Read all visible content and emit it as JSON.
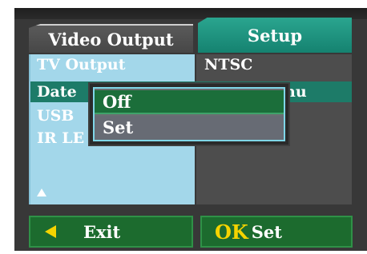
{
  "tabs": {
    "video_output": "Video Output",
    "setup": "Setup"
  },
  "menu": {
    "items": [
      {
        "label": "TV Output"
      },
      {
        "label": "Date"
      },
      {
        "label": "USB"
      },
      {
        "label": "IR LE"
      }
    ],
    "values": [
      {
        "label": "NTSC"
      },
      {
        "label": "nu"
      }
    ]
  },
  "popup": {
    "options": [
      {
        "label": "Off"
      },
      {
        "label": "Set"
      }
    ],
    "selected": "Off"
  },
  "footer": {
    "exit_label": "Exit",
    "ok_key": "OK",
    "ok_label": "Set"
  },
  "colors": {
    "accent_teal": "#158270",
    "selection_green": "#1b6e3a",
    "list_blue": "#a3d7ea",
    "key_yellow": "#f5d400"
  },
  "icons": {
    "exit": "left-triangle-icon",
    "scroll": "up-arrow-icon"
  }
}
